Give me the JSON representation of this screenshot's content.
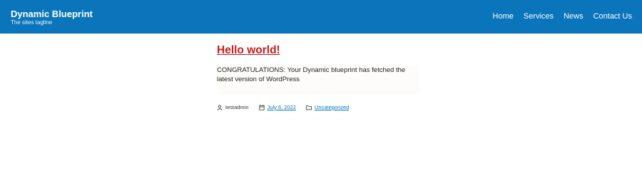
{
  "header": {
    "site_title": "Dynamic Blueprint",
    "tagline": "The sites tagline",
    "background_color": "#0a75bb",
    "nav": [
      "Home",
      "Services",
      "News",
      "Contact Us"
    ]
  },
  "post": {
    "title": "Hello world!",
    "title_color": "#cc1a1a",
    "excerpt": "CONGRATULATIONS: Your Dynamic blueprint has fetched the latest version of WordPress",
    "meta": {
      "author": "testadmin",
      "author_icon": "user-icon",
      "date": "July 6, 2022",
      "date_icon": "calendar-icon",
      "category": "Uncategorized",
      "category_icon": "folder-icon"
    }
  }
}
